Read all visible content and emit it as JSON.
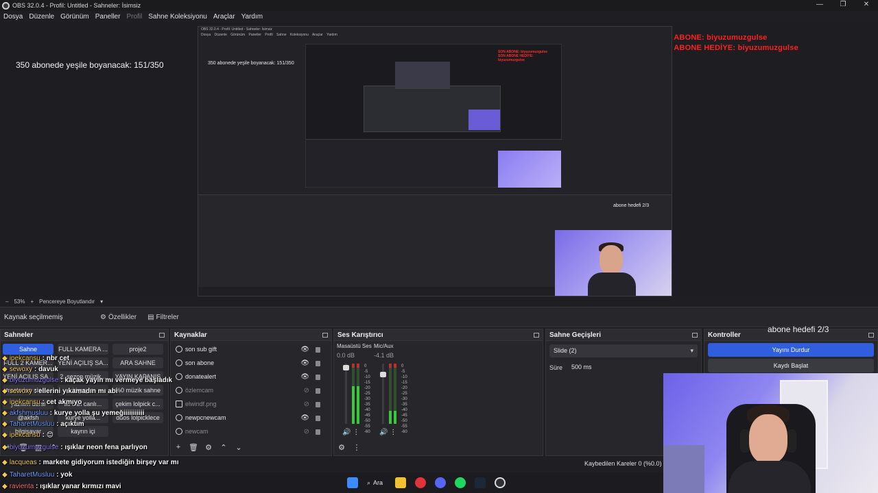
{
  "window": {
    "title": "OBS 32.0.4 - Profil: Untitled - Sahneler: İsimsiz"
  },
  "menu": [
    "Dosya",
    "Düzenle",
    "Görünüm",
    "Paneller",
    "Profil",
    "Sahne Koleksiyonu",
    "Araçlar",
    "Yardım"
  ],
  "preview": {
    "goal_text": "350 abonede yeşile boyanacak: 151/350",
    "alerts": [
      "SON ABONE: biyuzumuzgulse",
      "SON ABONE HEDİYE: biyuzumuzgulse"
    ],
    "hedef": "abone hedefi 2/3",
    "nested_hedef": "abone hedefi 2/3"
  },
  "preview_toolbar": {
    "minus": "–",
    "zoom": "53%",
    "plus": "+",
    "fit": "Pencereye Boyutlandır"
  },
  "source_bar": {
    "no_selection": "Kaynak seçilmemiş",
    "properties": "Özellikler",
    "filters": "Filtreler"
  },
  "scenes": {
    "title": "Sahneler",
    "items": [
      "Sahne",
      "FULL KAMERA ...",
      "proje2",
      "FULL 2 KAMER...",
      "YENİ AÇILIŞ SA...",
      "ARA SAHNE",
      "YENİ AÇILIŞ SA...",
      "2. sezon müzik...",
      "YAYIN KAPANIŞ",
      "tractorino sine...",
      "iri yayın",
      "%0 müzik sahne",
      "yazılım dersi",
      "iki can canlı...",
      "çekim lolpick c...",
      "@akfsh",
      "kurye yolla...",
      "ddos lolpicklece",
      "bilgisayar",
      "kayrın içi",
      ""
    ]
  },
  "sources": {
    "title": "Kaynaklar",
    "items": [
      {
        "name": "son sub gift",
        "visible": true
      },
      {
        "name": "son abone",
        "visible": true
      },
      {
        "name": "donatealert",
        "visible": true
      },
      {
        "name": "özlemcam",
        "visible": false
      },
      {
        "name": "elwindf.png",
        "visible": false
      },
      {
        "name": "newpcnewcam",
        "visible": true
      },
      {
        "name": "newcam",
        "visible": false
      }
    ]
  },
  "mixer": {
    "title": "Ses Karıştırıcı",
    "channels": [
      {
        "name": "Masaüstü Ses",
        "db": "0.0 dB",
        "level": 0.62
      },
      {
        "name": "Mic/Aux",
        "db": "-4.1 dB",
        "level": 0.22
      }
    ],
    "scale": [
      "0",
      "-5",
      "-10",
      "-15",
      "-20",
      "-25",
      "-30",
      "-35",
      "-40",
      "-45",
      "-50",
      "-55",
      "-60"
    ]
  },
  "transitions": {
    "title": "Sahne Geçişleri",
    "selected": "Slide (2)",
    "duration_label": "Süre",
    "duration": "500 ms"
  },
  "controls": {
    "title": "Kontroller",
    "stop_stream": "Yayını Durdur",
    "start_record": "Kaydı Başlat"
  },
  "status": {
    "dropped_frames": "Kaybedilen Kareler 0 (%0.0)"
  },
  "taskbar": {
    "search": "Ara"
  },
  "chat": [
    {
      "user": "ipekcansu",
      "text": ": nbr cet",
      "color": "#f2c94c"
    },
    {
      "user": "sewoxy",
      "text": ": davuk",
      "color": "#ffd36b"
    },
    {
      "user": "biyuzumuzgulse",
      "text": ": kaçak yayın mı vermeye başladık",
      "color": "#8e7cf4"
    },
    {
      "user": "sewoxy",
      "text": ": ellerini yıkamadın mı abi",
      "color": "#ffd36b"
    },
    {
      "user": "ipekcansu",
      "text": ": cet akmıyo",
      "color": "#f2c94c"
    },
    {
      "user": "akfshmusluu",
      "text": ": kurye yolla şu yemeğiiiiiiiiiii",
      "color": "#6fa0ff"
    },
    {
      "user": "TaharetMusluu",
      "text": ": açıktım",
      "color": "#6fa0ff"
    },
    {
      "user": "ipekcansu",
      "text": ": 😊",
      "color": "#f2c94c"
    },
    {
      "user": "biyuzumuzgulse",
      "text": ": ışıklar neon fena parlıyon",
      "color": "#8e7cf4"
    },
    {
      "user": "lacqueas",
      "text": ": markete gidiyorum istediğin birşey var mı",
      "color": "#f2c94c"
    },
    {
      "user": "TaharetMusluu",
      "text": ": yok",
      "color": "#6fa0ff"
    },
    {
      "user": "ravienta",
      "text": ": ışıklar yanar kırmızı mavi",
      "color": "#ff6b6b"
    }
  ],
  "colors": {
    "accent": "#2f5fde",
    "alert": "#ff2020",
    "bg": "#1f1f23",
    "panel": "#27272b"
  }
}
